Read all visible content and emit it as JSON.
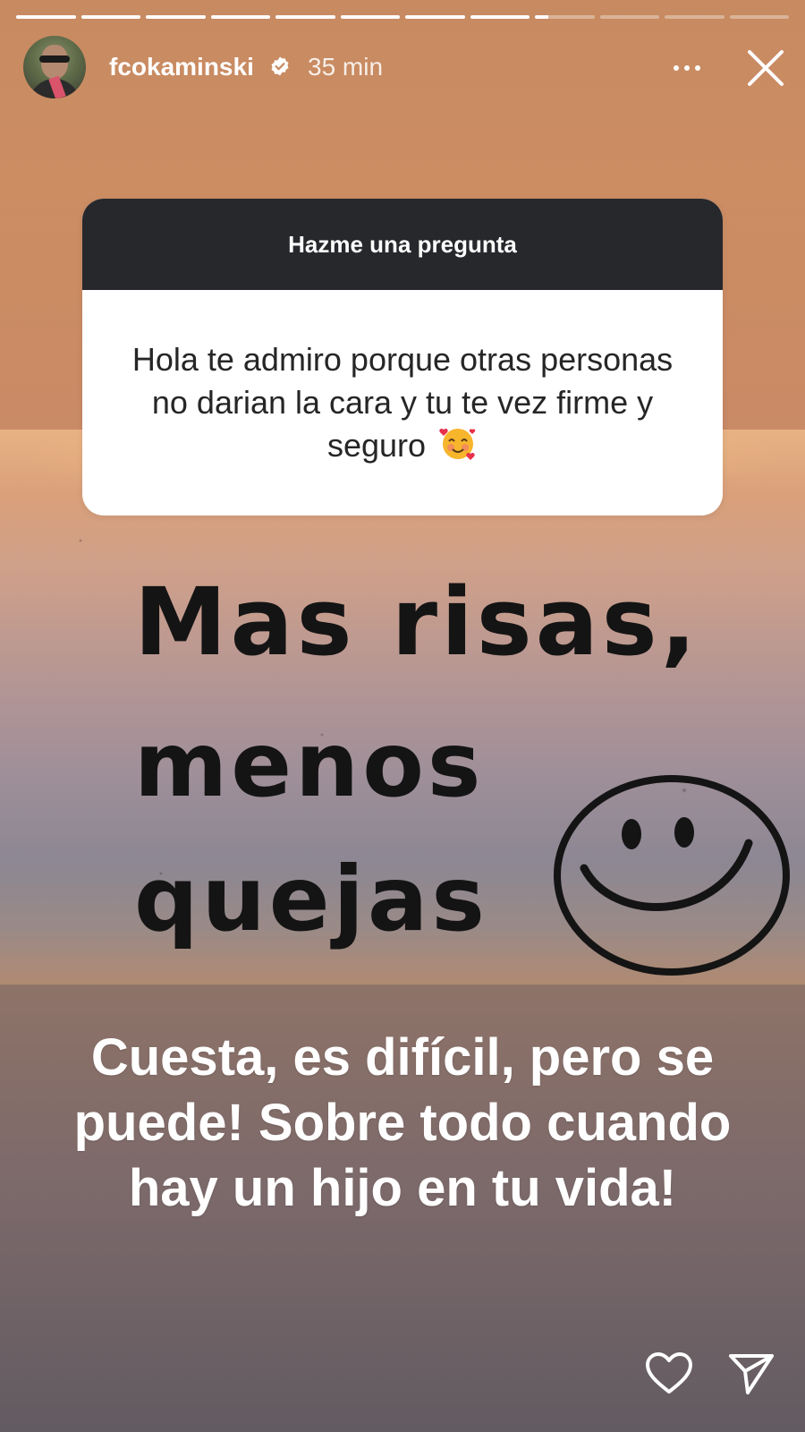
{
  "story": {
    "progress": {
      "segments": 12,
      "current_index": 8,
      "current_fill": 0.22
    },
    "header": {
      "username": "fcokaminski",
      "verified": true,
      "time": "35 min",
      "more_icon": "more-horizontal-icon",
      "close_icon": "close-icon"
    },
    "question_sticker": {
      "title": "Hazme una pregunta",
      "question": "Hola te admiro porque otras personas no darian la cara y tu te vez firme y seguro",
      "emoji": "smiling-face-with-hearts"
    },
    "image_text": {
      "line1": "Mas risas,",
      "line2": "menos",
      "line3": "quejas",
      "drawing": "smiley-face"
    },
    "caption": "Cuesta, es difícil, pero se puede! Sobre todo cuando hay un hijo en tu vida!",
    "actions": {
      "like_icon": "heart-icon",
      "share_icon": "send-icon"
    },
    "colors": {
      "sticker_header": "#26282c",
      "caption_text": "#ffffff"
    }
  }
}
